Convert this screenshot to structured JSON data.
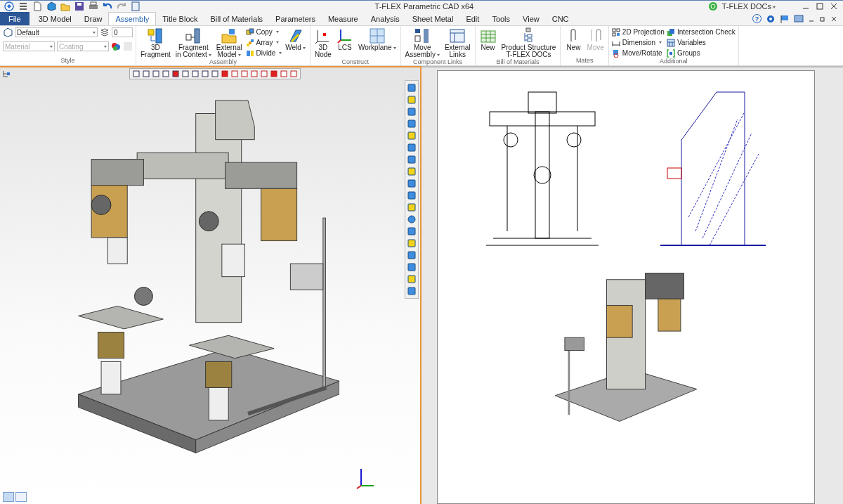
{
  "window": {
    "title": "T-FLEX Parametric CAD x64",
    "account": "T-FLEX DOCs",
    "help": "?"
  },
  "tabs": [
    {
      "label": "File",
      "selected": false,
      "kind": "file"
    },
    {
      "label": "3D Model",
      "selected": false,
      "kind": "tab"
    },
    {
      "label": "Draw",
      "selected": false,
      "kind": "tab"
    },
    {
      "label": "Assembly",
      "selected": true,
      "kind": "tab"
    },
    {
      "label": "Title Block",
      "selected": false,
      "kind": "tab"
    },
    {
      "label": "Bill of Materials",
      "selected": false,
      "kind": "tab"
    },
    {
      "label": "Parameters",
      "selected": false,
      "kind": "tab"
    },
    {
      "label": "Measure",
      "selected": false,
      "kind": "tab"
    },
    {
      "label": "Analysis",
      "selected": false,
      "kind": "tab"
    },
    {
      "label": "Sheet Metal",
      "selected": false,
      "kind": "tab"
    },
    {
      "label": "Edit",
      "selected": false,
      "kind": "tab"
    },
    {
      "label": "Tools",
      "selected": false,
      "kind": "tab"
    },
    {
      "label": "View",
      "selected": false,
      "kind": "tab"
    },
    {
      "label": "CNC",
      "selected": false,
      "kind": "tab"
    }
  ],
  "style_group": {
    "label": "Style",
    "style": "Default",
    "layer": "0",
    "material": "Material",
    "coating": "Coating"
  },
  "groups": [
    {
      "label": "Assembly",
      "buttons": [
        {
          "kind": "large",
          "lines": [
            "3D",
            "Fragment"
          ],
          "dropdown": false,
          "disabled": false
        },
        {
          "kind": "large",
          "lines": [
            "Fragment",
            "in Context"
          ],
          "dropdown": true,
          "disabled": false
        },
        {
          "kind": "large",
          "lines": [
            "External",
            "Model"
          ],
          "dropdown": true,
          "disabled": false
        },
        {
          "kind": "small",
          "lines": [
            "Copy"
          ],
          "dropdown": true,
          "disabled": false
        },
        {
          "kind": "small",
          "lines": [
            "Array"
          ],
          "dropdown": true,
          "disabled": false
        },
        {
          "kind": "small",
          "lines": [
            "Divide"
          ],
          "dropdown": true,
          "disabled": false
        },
        {
          "kind": "large",
          "lines": [
            "Weld"
          ],
          "dropdown": true,
          "disabled": false
        }
      ]
    },
    {
      "label": "Construct",
      "buttons": [
        {
          "kind": "large",
          "lines": [
            "3D",
            "Node"
          ],
          "dropdown": false,
          "disabled": false
        },
        {
          "kind": "large",
          "lines": [
            "LCS"
          ],
          "dropdown": false,
          "disabled": false
        },
        {
          "kind": "large",
          "lines": [
            "Workplane"
          ],
          "dropdown": true,
          "disabled": false
        }
      ]
    },
    {
      "label": "Component Links",
      "buttons": [
        {
          "kind": "large",
          "lines": [
            "Move",
            "Assembly"
          ],
          "dropdown": true,
          "disabled": false
        },
        {
          "kind": "large",
          "lines": [
            "External",
            "Links"
          ],
          "dropdown": false,
          "disabled": false
        }
      ]
    },
    {
      "label": "Bill of Materials",
      "buttons": [
        {
          "kind": "large",
          "lines": [
            "New"
          ],
          "dropdown": false,
          "disabled": false
        },
        {
          "kind": "large",
          "lines": [
            "Product Structure",
            "T-FLEX DOCs"
          ],
          "dropdown": false,
          "disabled": false
        }
      ]
    },
    {
      "label": "Mates",
      "buttons": [
        {
          "kind": "large",
          "lines": [
            "New"
          ],
          "dropdown": false,
          "disabled": false
        },
        {
          "kind": "large",
          "lines": [
            "Move"
          ],
          "dropdown": false,
          "disabled": true
        }
      ]
    },
    {
      "label": "Additional",
      "buttons": [
        {
          "kind": "small",
          "lines": [
            "2D Projection"
          ],
          "dropdown": false,
          "disabled": false
        },
        {
          "kind": "small",
          "lines": [
            "Dimension"
          ],
          "dropdown": true,
          "disabled": false
        },
        {
          "kind": "small",
          "lines": [
            "Move/Rotate"
          ],
          "dropdown": false,
          "disabled": false
        },
        {
          "kind": "small",
          "lines": [
            "Intersection Check"
          ],
          "dropdown": false,
          "disabled": false
        },
        {
          "kind": "small",
          "lines": [
            "Variables"
          ],
          "dropdown": false,
          "disabled": false
        },
        {
          "kind": "small",
          "lines": [
            "Groups"
          ],
          "dropdown": false,
          "disabled": false
        }
      ]
    }
  ],
  "viewport": {
    "active": true
  },
  "bottom_views": [
    {
      "selected": true
    },
    {
      "selected": false
    }
  ]
}
